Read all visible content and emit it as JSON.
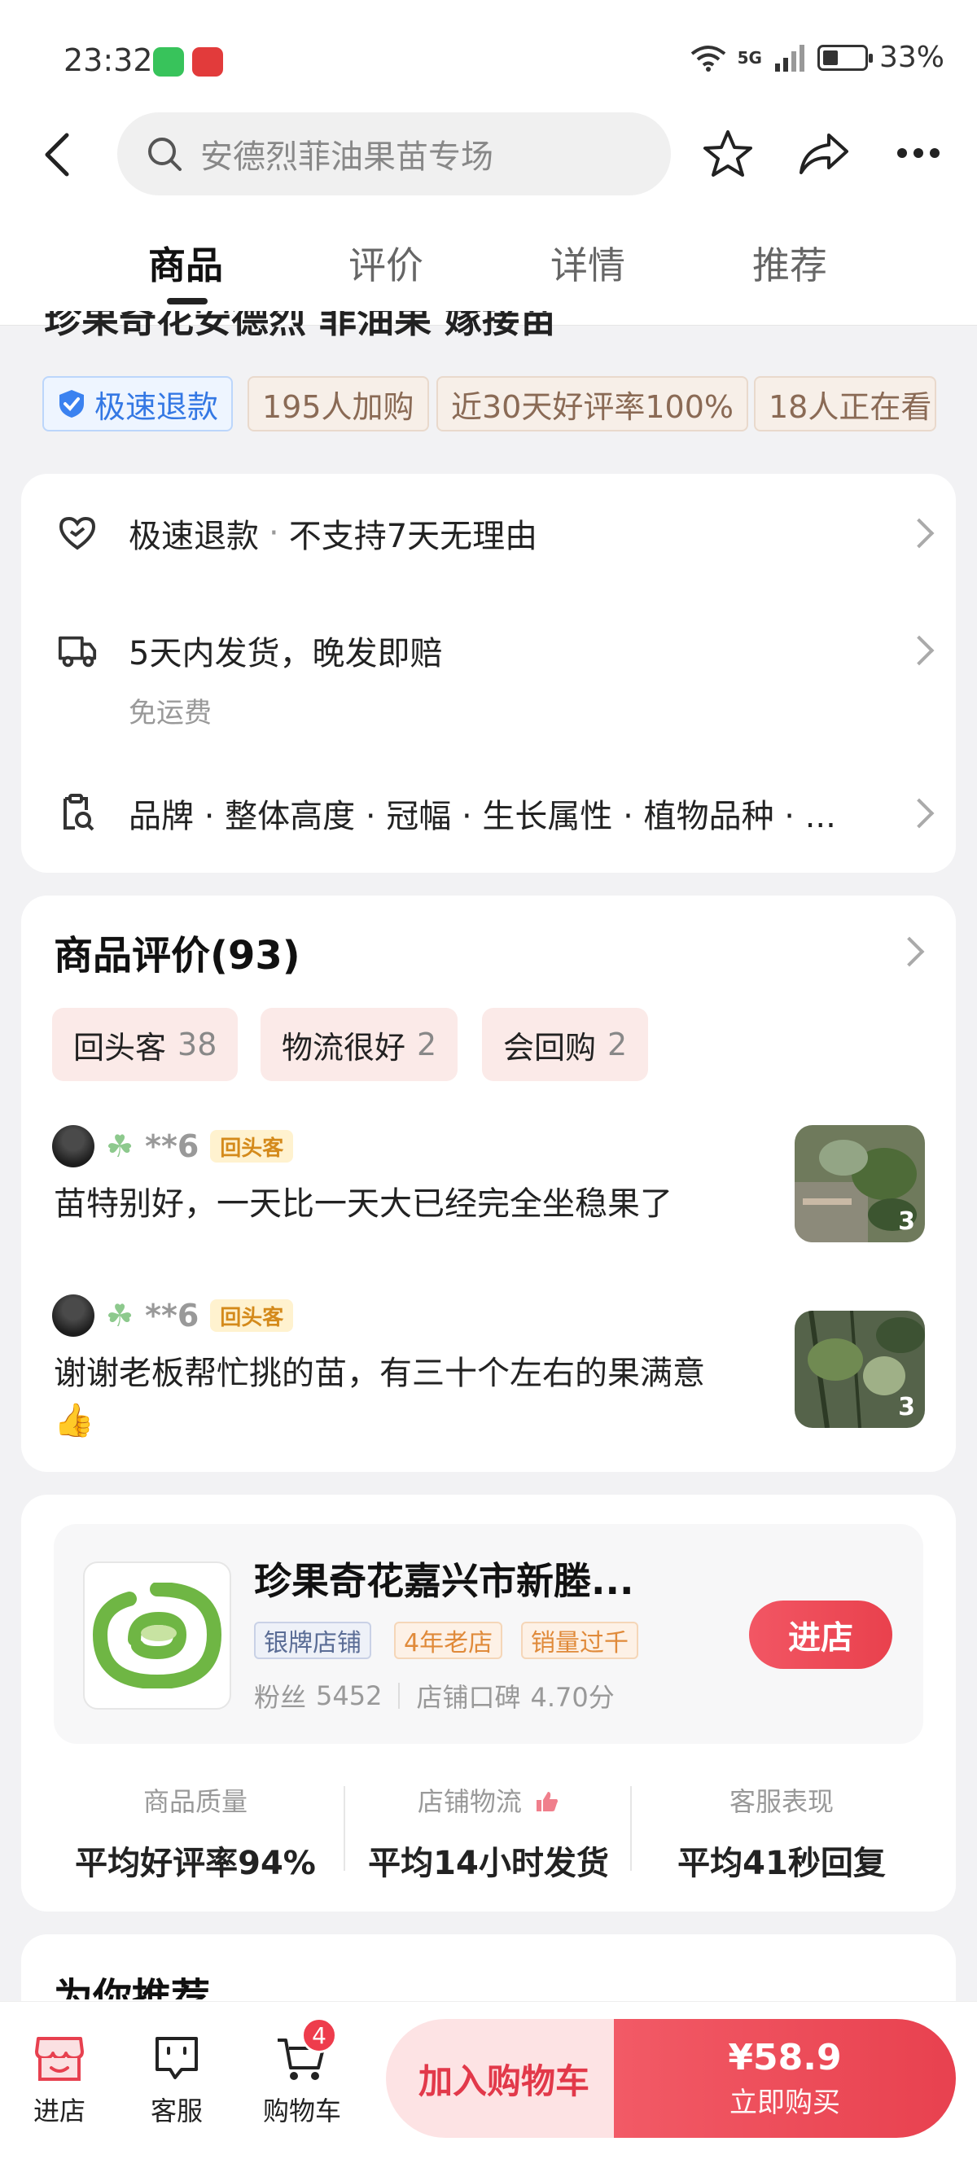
{
  "status_bar": {
    "time": "23:32",
    "network": "5G",
    "battery": "33%"
  },
  "header": {
    "search_placeholder": "安德烈菲油果苗专场"
  },
  "tabs": [
    {
      "label": "商品"
    },
    {
      "label": "评价"
    },
    {
      "label": "详情"
    },
    {
      "label": "推荐"
    }
  ],
  "product": {
    "title_partial": "珍果奇花安德烈 菲油果 嫁接苗",
    "tags": [
      "极速退款",
      "195人加购",
      "近30天好评率100%",
      "18人正在看"
    ]
  },
  "services": {
    "refund_label": "极速退款",
    "refund_note": "不支持7天无理由",
    "shipping_label": "5天内发货，晚发即赔",
    "shipping_sub": "免运费",
    "params_label": "品牌 · 整体高度 · 冠幅 · 生长属性 · 植物品种 · ..."
  },
  "reviews": {
    "title": "商品评价(93)",
    "chips": [
      {
        "label": "回头客",
        "count": "38"
      },
      {
        "label": "物流很好",
        "count": "2"
      },
      {
        "label": "会回购",
        "count": "2"
      }
    ],
    "items": [
      {
        "user": "**6",
        "badge": "回头客",
        "text": "苗特别好，一天比一天大已经完全坐稳果了",
        "photo_count": "3"
      },
      {
        "user": "**6",
        "badge": "回头客",
        "text": "谢谢老板帮忙挑的苗，有三十个左右的果满意",
        "emoji": "👍",
        "photo_count": "3"
      }
    ]
  },
  "shop": {
    "name": "珍果奇花嘉兴市新塍...",
    "tags": [
      "银牌店铺",
      "4年老店",
      "销量过千"
    ],
    "fans_label": "粉丝",
    "fans": "5452",
    "rating_label": "店铺口碑",
    "rating": "4.70分",
    "enter_label": "进店",
    "metrics": [
      {
        "label": "商品质量",
        "value": "平均好评率94%"
      },
      {
        "label": "店铺物流",
        "value": "平均14小时发货"
      },
      {
        "label": "客服表现",
        "value": "平均41秒回复"
      }
    ]
  },
  "recommend": {
    "title": "为你推荐"
  },
  "bottom_bar": {
    "shop_label": "进店",
    "service_label": "客服",
    "cart_label": "购物车",
    "cart_count": "4",
    "add_cart_label": "加入购物车",
    "price": "¥58.9",
    "buy_label": "立即购买"
  },
  "colors": {
    "accent": "#e9414d",
    "refund_blue": "#3478e4",
    "shop_green": "#6fb644"
  }
}
